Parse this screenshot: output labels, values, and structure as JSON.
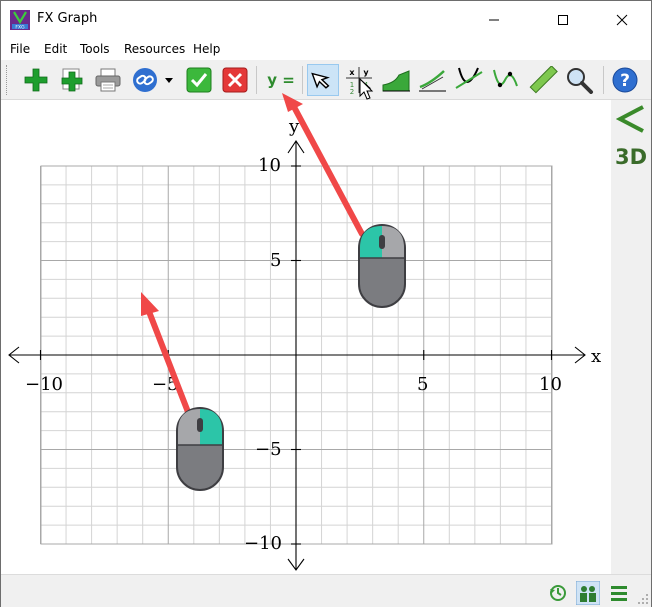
{
  "window": {
    "title": "FX Graph"
  },
  "menu": {
    "items": [
      "File",
      "Edit",
      "Tools",
      "Resources",
      "Help"
    ]
  },
  "toolbar": {
    "y_equals_label": "y ="
  },
  "side_panel": {
    "label_3d": "3D"
  },
  "graph": {
    "x_axis_label": "x",
    "y_axis_label": "y",
    "x_tick_labels": [
      "−10",
      "−5",
      "5",
      "10"
    ],
    "y_tick_labels": [
      "10",
      "5",
      "−5",
      "−10"
    ],
    "xlim": [
      -10,
      10
    ],
    "ylim": [
      -10,
      10
    ],
    "grid": true
  },
  "colors": {
    "accent_green": "#2e8b2e",
    "arrow_red": "#f04848",
    "mouse_teal": "#2cc5a8",
    "mouse_gray": "#7b7c80"
  }
}
